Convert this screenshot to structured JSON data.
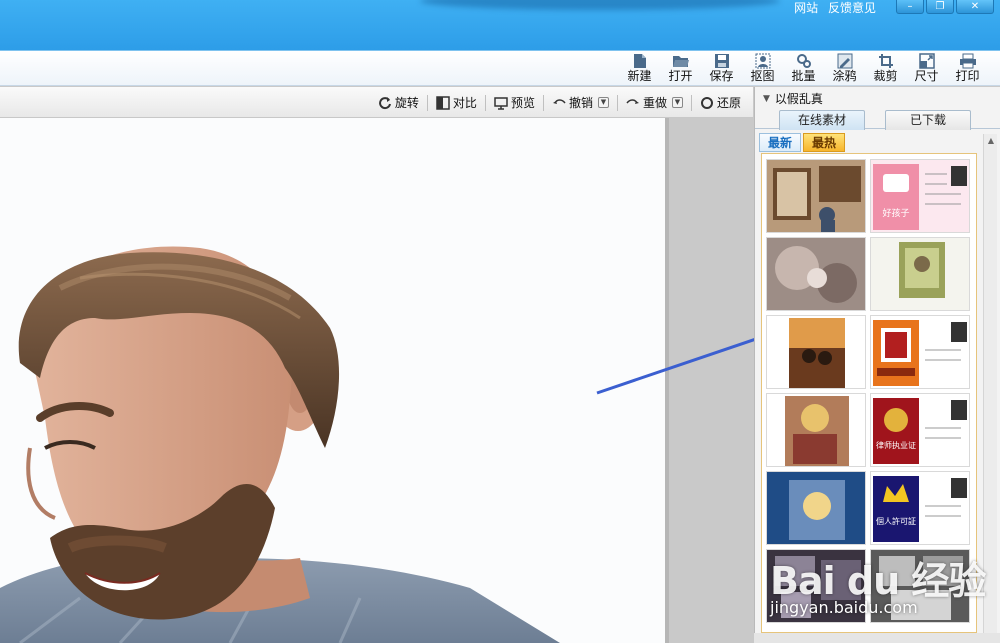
{
  "top_links": [
    "网站",
    "反馈意见"
  ],
  "window_controls": {
    "minimize": "–",
    "restore": "❐",
    "close": "✕"
  },
  "toolbar": [
    {
      "label": "新建",
      "icon": "new-file-icon"
    },
    {
      "label": "打开",
      "icon": "folder-open-icon"
    },
    {
      "label": "保存",
      "icon": "save-icon"
    },
    {
      "label": "抠图",
      "icon": "cutout-icon"
    },
    {
      "label": "批量",
      "icon": "batch-icon"
    },
    {
      "label": "涂鸦",
      "icon": "doodle-icon"
    },
    {
      "label": "裁剪",
      "icon": "crop-icon"
    },
    {
      "label": "尺寸",
      "icon": "resize-icon"
    },
    {
      "label": "打印",
      "icon": "printer-icon"
    }
  ],
  "canvas_toolbar": {
    "rotate": "旋转",
    "compare": "对比",
    "preview": "预览",
    "undo": "撤销",
    "redo": "重做",
    "restore": "还原"
  },
  "panel": {
    "title": "以假乱真",
    "tabs": [
      "在线素材",
      "已下载"
    ],
    "active_tab": "在线素材",
    "subtabs": [
      "最新",
      "最热"
    ],
    "active_subtab": "最热",
    "thumbnails": [
      {
        "caption": "",
        "theme": "photo-frame-couple"
      },
      {
        "caption": "好孩子",
        "theme": "pink-certificate"
      },
      {
        "caption": "",
        "theme": "vintage-collage"
      },
      {
        "caption": "",
        "theme": "green-frame"
      },
      {
        "caption": "",
        "theme": "sunset-couple"
      },
      {
        "caption": "",
        "theme": "orange-certificate"
      },
      {
        "caption": "",
        "theme": "blonde-woman"
      },
      {
        "caption": "律师执业证",
        "theme": "red-license"
      },
      {
        "caption": "",
        "theme": "blue-portrait"
      },
      {
        "caption": "個人許可証",
        "theme": "crown-license"
      },
      {
        "caption": "",
        "theme": "dark-collage"
      },
      {
        "caption": "",
        "theme": "grey-frames"
      }
    ]
  },
  "watermark": {
    "brand": "Bai du 经验",
    "url": "jingyan.baidu.com"
  },
  "colors": {
    "titlebar": "#37a8f0",
    "arrow": "#3b5fd0",
    "hot_tab": "#f7b52c"
  }
}
